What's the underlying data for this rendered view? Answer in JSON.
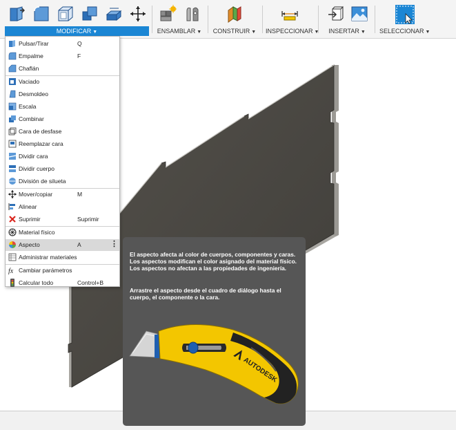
{
  "toolbar": {
    "groups": [
      {
        "label": "MODIFICAR",
        "active": true
      },
      {
        "label": "ENSAMBLAR",
        "active": false
      },
      {
        "label": "CONSTRUIR",
        "active": false
      },
      {
        "label": "INSPECCIONAR",
        "active": false
      },
      {
        "label": "INSERTAR",
        "active": false
      },
      {
        "label": "SELECCIONAR",
        "active": false
      }
    ],
    "icons": [
      "press-pull-icon",
      "fillet-icon",
      "shell-icon",
      "combine-icon",
      "scale-icon",
      "move-icon",
      "new-component-icon",
      "joint-icon",
      "construct-plane-icon",
      "measure-icon",
      "insert-derive-icon",
      "insert-image-icon",
      "select-icon"
    ]
  },
  "menu": {
    "items": [
      {
        "label": "Pulsar/Tirar",
        "shortcut": "Q",
        "icon": "press-pull-icon"
      },
      {
        "label": "Empalme",
        "shortcut": "F",
        "icon": "fillet-icon"
      },
      {
        "label": "Chaflán",
        "shortcut": "",
        "icon": "chamfer-icon"
      },
      {
        "label": "Vaciado",
        "shortcut": "",
        "icon": "shell-icon"
      },
      {
        "label": "Desmoldeo",
        "shortcut": "",
        "icon": "draft-icon"
      },
      {
        "label": "Escala",
        "shortcut": "",
        "icon": "scale-icon"
      },
      {
        "label": "Combinar",
        "shortcut": "",
        "icon": "combine-icon"
      },
      {
        "label": "Cara de desfase",
        "shortcut": "",
        "icon": "offset-face-icon"
      },
      {
        "label": "Reemplazar cara",
        "shortcut": "",
        "icon": "replace-face-icon"
      },
      {
        "label": "Dividir cara",
        "shortcut": "",
        "icon": "split-face-icon"
      },
      {
        "label": "Dividir cuerpo",
        "shortcut": "",
        "icon": "split-body-icon"
      },
      {
        "label": "División de silueta",
        "shortcut": "",
        "icon": "silhouette-split-icon"
      },
      {
        "label": "Mover/copiar",
        "shortcut": "M",
        "icon": "move-icon"
      },
      {
        "label": "Alinear",
        "shortcut": "",
        "icon": "align-icon"
      },
      {
        "label": "Suprimir",
        "shortcut": "Suprimir",
        "icon": "delete-icon"
      },
      {
        "label": "Material físico",
        "shortcut": "",
        "icon": "physical-material-icon"
      },
      {
        "label": "Aspecto",
        "shortcut": "A",
        "icon": "appearance-icon"
      },
      {
        "label": "Administrar materiales",
        "shortcut": "",
        "icon": "manage-materials-icon"
      },
      {
        "label": "Cambiar parámetros",
        "shortcut": "",
        "icon": "parameters-icon"
      },
      {
        "label": "Calcular todo",
        "shortcut": "Control+B",
        "icon": "compute-all-icon"
      }
    ],
    "highlighted_index": 16
  },
  "tooltip": {
    "text1": "El aspecto afecta al color de cuerpos, componentes y caras. Los aspectos modifican el color asignado del material físico. Los aspectos no afectan a las propiedades de ingeniería.",
    "text2": "Arrastre el aspecto desde el cuadro de diálogo hasta el cuerpo, el componente o la cara.",
    "brand": "AUTODESK"
  },
  "colors": {
    "accent": "#1b86d4",
    "plate": "#4a4843",
    "tooltip_bg": "#565656",
    "knife_yellow": "#f3c600"
  }
}
